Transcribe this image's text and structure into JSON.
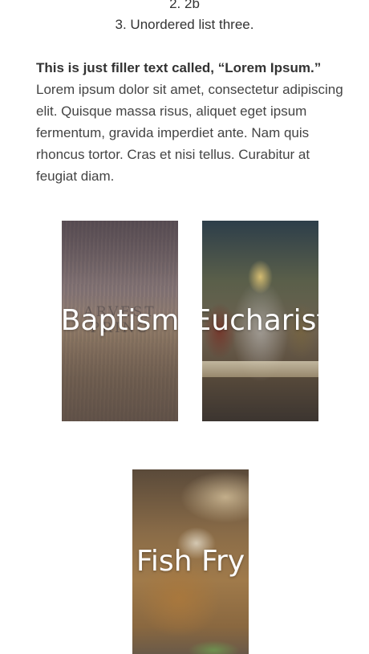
{
  "list": {
    "items": [
      {
        "text": "2. 2b"
      },
      {
        "text": "3. Unordered list three."
      }
    ]
  },
  "filler": {
    "bold_text": "This is just filler text called, “Lorem Ipsum.”",
    "body_text": " Lorem ipsum dolor sit amet, consectetur adipiscing elit. Quisque massa risus, aliquet eget ipsum fermentum, gravida imperdiet ante. Nam quis rhoncus tortor. Cras et nisi tellus. Curabitur at feugiat diam."
  },
  "cards": {
    "baptism": {
      "label": "Baptism",
      "watermark": "ARVEST PRINC"
    },
    "eucharist": {
      "label": "Eucharist"
    },
    "fishfry": {
      "label": "Fish Fry"
    }
  }
}
